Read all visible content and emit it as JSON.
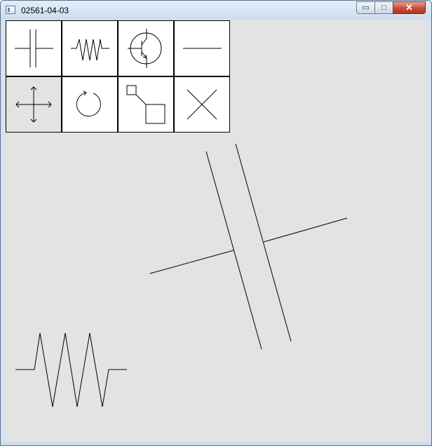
{
  "window": {
    "title": "02561-04-03",
    "minimize_symbol": "▭",
    "maximize_symbol": "□",
    "close_symbol": "✕"
  },
  "toolbar": {
    "tools": [
      {
        "name": "capacitor",
        "icon": "capacitor-icon",
        "selected": false
      },
      {
        "name": "resistor",
        "icon": "resistor-icon",
        "selected": false
      },
      {
        "name": "transistor",
        "icon": "transistor-icon",
        "selected": false
      },
      {
        "name": "wire",
        "icon": "wire-icon",
        "selected": false
      },
      {
        "name": "move",
        "icon": "move-arrows-icon",
        "selected": true
      },
      {
        "name": "rotate",
        "icon": "rotate-icon",
        "selected": false
      },
      {
        "name": "connect",
        "icon": "connect-icon",
        "selected": false
      },
      {
        "name": "delete",
        "icon": "delete-x-icon",
        "selected": false
      }
    ]
  },
  "canvas": {
    "background": "#e3e3e3",
    "components": [
      {
        "type": "capacitor",
        "rotation": "tilted"
      },
      {
        "type": "resistor",
        "rotation": "horizontal"
      }
    ]
  }
}
